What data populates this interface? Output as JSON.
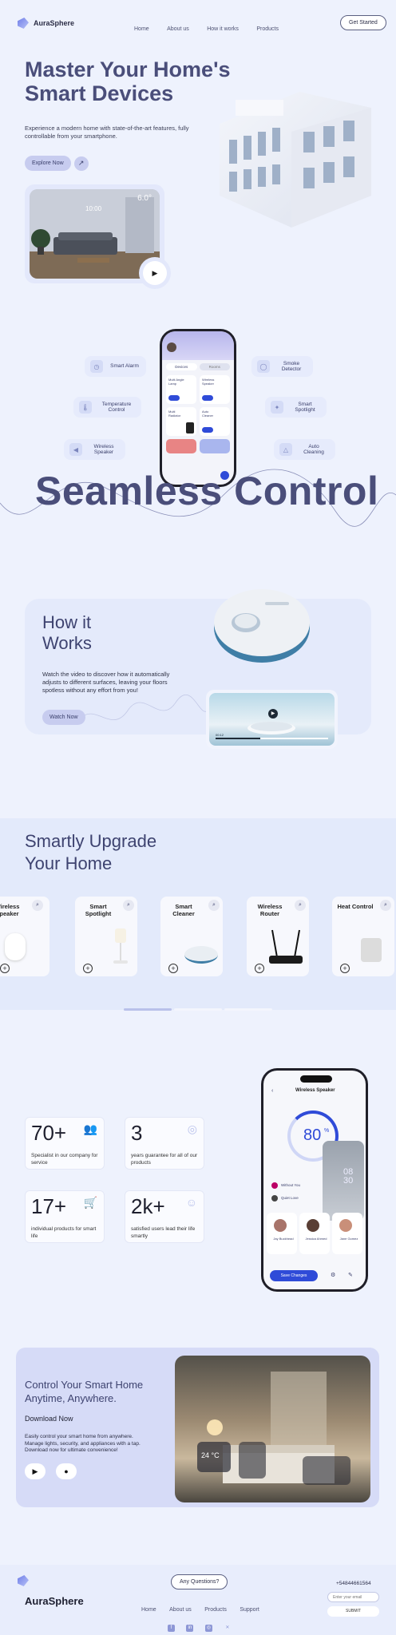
{
  "brand": {
    "name": "AuraSphere"
  },
  "nav": {
    "items": [
      "Home",
      "About us",
      "How it works",
      "Products"
    ],
    "cta": "Get Started"
  },
  "hero": {
    "title_line1": "Master Your Home's",
    "title_line2": "Smart Devices",
    "subtitle": "Experience a modern home with state-of-the-art features, fully controllable from your smartphone.",
    "cta": "Explore Now",
    "room_temp": "6.0°",
    "room_time": "10:00",
    "play_icon": "play-icon"
  },
  "control": {
    "features": [
      "Smart Alarm",
      "Smoke Detector",
      "Temperature Control",
      "Smart Spotlight",
      "Wireless Speaker",
      "Auto Cleaning"
    ],
    "title": "Seamless Control",
    "phone": {
      "tabs": [
        "Devices",
        "Rooms"
      ],
      "devices": [
        "Multi Angle Lamp",
        "Wireless Speaker",
        "Multi Radiator",
        "Auto Cleaner"
      ]
    }
  },
  "how": {
    "title_line1": "How it",
    "title_line2": "Works",
    "text": "Watch the video to discover how it automatically adjusts to different surfaces, leaving your floors spotless without any effort from you!",
    "cta": "Watch Now",
    "video_time": "00:12"
  },
  "upgrade": {
    "title_line1": "Smartly Upgrade",
    "title_line2": "Your Home",
    "products": [
      "Wireless Speaker",
      "Smart Spotlight",
      "Smart Cleaner",
      "Wireless Router",
      "Heat Control"
    ]
  },
  "stats": [
    {
      "num": "70+",
      "desc": "Specialist in our company for service"
    },
    {
      "num": "3",
      "desc": "years guarantee for all of our products"
    },
    {
      "num": "17+",
      "desc": "individual products for smart life"
    },
    {
      "num": "2k+",
      "desc": "satisfied users lead their life smartly"
    }
  ],
  "speaker_app": {
    "title": "Wireless Speaker",
    "value": "80",
    "unit": "%",
    "clock": "08 30",
    "items": [
      "Without You",
      "Quiet Love"
    ],
    "contacts": [
      "Jay Buckhead",
      "Jessica Ahmed",
      "Jane Gomez"
    ],
    "button": "Save Changes"
  },
  "download": {
    "title_line1": "Control Your Smart Home",
    "title_line2": "Anytime, Anywhere.",
    "subtitle": "Download Now",
    "text": "Easily control your smart home from anywhere. Manage lights, security, and appliances with a tap. Download now for ultimate convenience!",
    "temp": "24 °C"
  },
  "footer": {
    "question_button": "Any Questions?",
    "links": [
      "Home",
      "About us",
      "Products",
      "Support"
    ],
    "phone": "+54844661564",
    "email_placeholder": "Enter your email",
    "submit": "SUBMIT"
  },
  "colors": {
    "accent": "#2f4bd8",
    "navy": "#4a4e7a",
    "soft": "#c7ccef"
  }
}
